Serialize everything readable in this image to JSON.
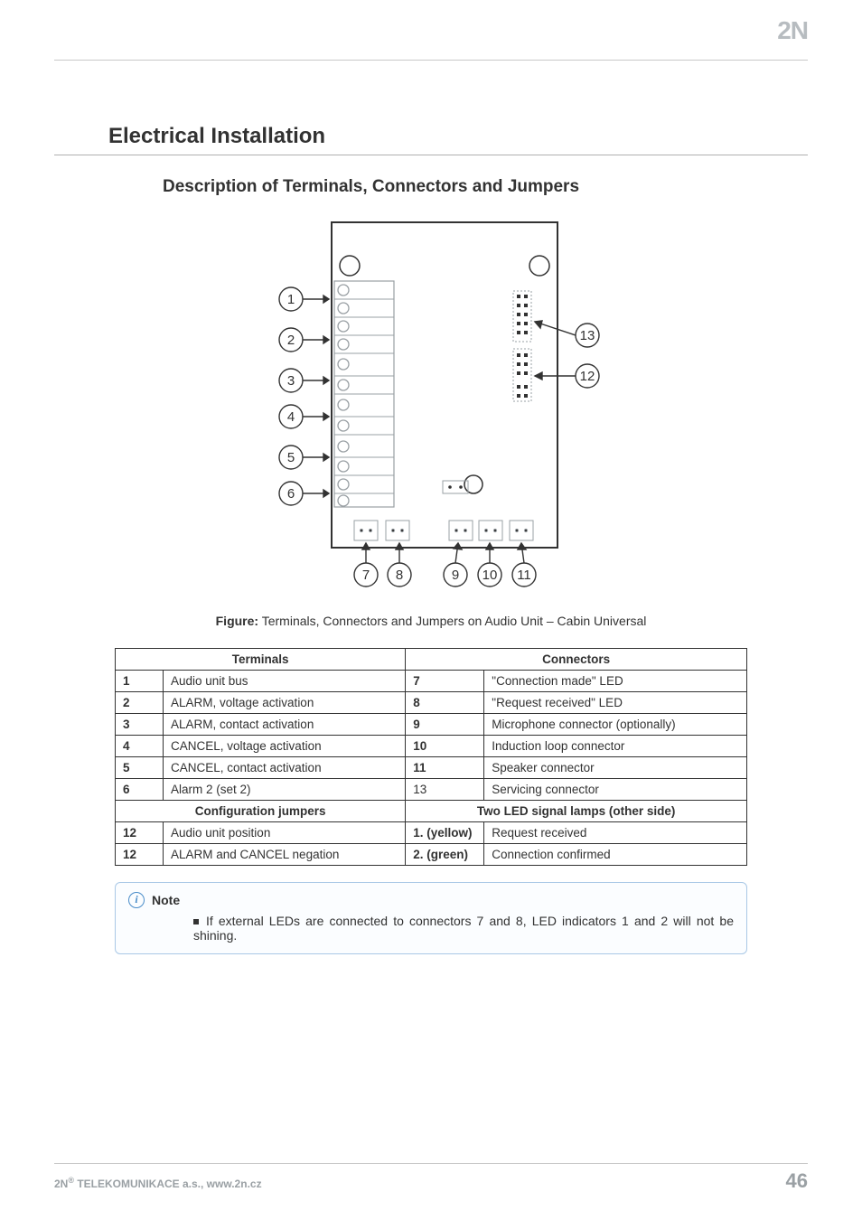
{
  "brand_logo": "2N",
  "section_title": "Electrical Installation",
  "subsection_title": "Description of Terminals, Connectors and Jumpers",
  "diagram": {
    "left_callouts": [
      "1",
      "2",
      "3",
      "4",
      "5",
      "6"
    ],
    "bottom_callouts": [
      "7",
      "8",
      "9",
      "10",
      "11"
    ],
    "right_callouts": [
      "13",
      "12"
    ]
  },
  "figure_label": "Figure:",
  "figure_text": "Terminals, Connectors and Jumpers on Audio Unit – Cabin Universal",
  "table": {
    "header_left": "Terminals",
    "header_right": "Connectors",
    "rows1": [
      {
        "lnum": "1",
        "ltext": "Audio unit bus",
        "rnum": "7",
        "rtext": "\"Connection made\" LED"
      },
      {
        "lnum": "2",
        "ltext": "ALARM, voltage activation",
        "rnum": "8",
        "rtext": "\"Request received\" LED"
      },
      {
        "lnum": "3",
        "ltext": "ALARM, contact activation",
        "rnum": "9",
        "rtext": "Microphone connector (optionally)"
      },
      {
        "lnum": "4",
        "ltext": "CANCEL, voltage activation",
        "rnum": "10",
        "rtext": "Induction loop connector"
      },
      {
        "lnum": "5",
        "ltext": "CANCEL, contact activation",
        "rnum": "11",
        "rtext": "Speaker connector"
      },
      {
        "lnum": "6",
        "ltext": "Alarm 2 (set 2)",
        "rnum": "13",
        "rtext": "Servicing connector"
      }
    ],
    "header2_left": "Configuration jumpers",
    "header2_right": "Two LED signal lamps (other side)",
    "rows2": [
      {
        "lnum": "12",
        "ltext": "Audio unit position",
        "rnum": "1. (yellow)",
        "rtext": "Request received"
      },
      {
        "lnum": "12",
        "ltext": "ALARM and CANCEL negation",
        "rnum": "2. (green)",
        "rtext": "Connection confirmed"
      }
    ]
  },
  "note": {
    "label": "Note",
    "text": "If external LEDs are connected to connectors 7 and 8, LED indicators 1 and 2 will not be shining."
  },
  "footer": {
    "left_prefix": "2N",
    "left_sup": "®",
    "left_rest": " TELEKOMUNIKACE a.s., www.2n.cz",
    "page_number": "46"
  }
}
